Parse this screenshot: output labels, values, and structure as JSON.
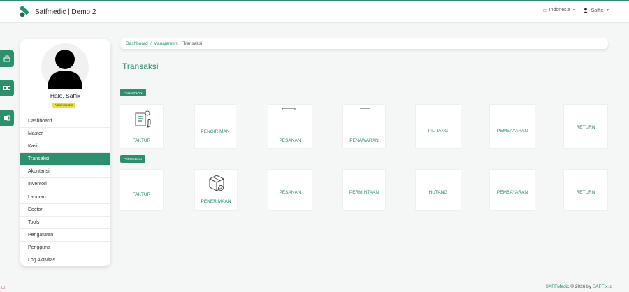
{
  "header": {
    "app_title": "Saffmedic | Demo 2",
    "language": "Indonesia",
    "username": "Saffix"
  },
  "colors": {
    "accent": "#2e8f6c",
    "role_badge": "#f0dc3c"
  },
  "profile": {
    "greeting": "Halo, Saffix",
    "role": "Administrator"
  },
  "menu": [
    {
      "label": "Dashboard"
    },
    {
      "label": "Master"
    },
    {
      "label": "Kasir"
    },
    {
      "label": "Transaksi",
      "active": true
    },
    {
      "label": "Akuntansi"
    },
    {
      "label": "Inventori"
    },
    {
      "label": "Laporan"
    },
    {
      "label": "Doctor"
    },
    {
      "label": "Tools"
    },
    {
      "label": "Pengaturan"
    },
    {
      "label": "Pengguna"
    },
    {
      "label": "Log Aktivitas"
    }
  ],
  "side_tabs": [
    "cash-register-icon",
    "money-icon",
    "book-icon"
  ],
  "breadcrumb": {
    "home": "Dashboard",
    "parent": "Manajemen",
    "current": "Transaksi"
  },
  "page": {
    "title": "Transaksi"
  },
  "sections": {
    "sales": {
      "badge": "PENJUALAN",
      "tiles": [
        "FAKTUR",
        "PENGIRIMAN",
        "PESANAN",
        "PENAWARAN",
        "PIUTANG",
        "PEMBAYARAN",
        "RETURN"
      ]
    },
    "purchase": {
      "badge": "PEMBELIAN",
      "tiles": [
        "FAKTUR",
        "PENERIMAAN",
        "PESANAN",
        "PERMINTAAN",
        "HUTANG",
        "PEMBAYARAN",
        "RETURN"
      ]
    }
  },
  "footer": {
    "brand": "SAFFMedic",
    "text": " © 2026 by ",
    "link": "SAFFix.id"
  }
}
